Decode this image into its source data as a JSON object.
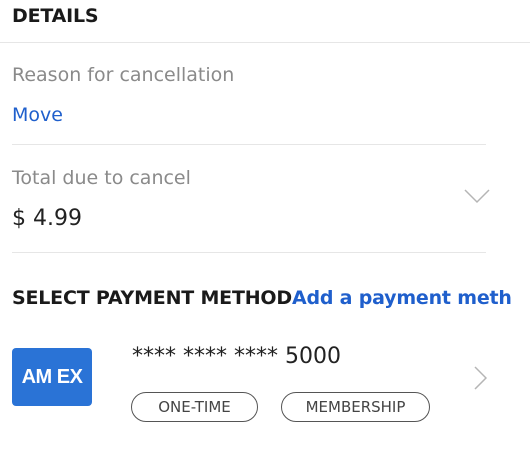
{
  "details": {
    "header": "DETAILS",
    "reason": {
      "label": "Reason for cancellation",
      "value": "Move"
    },
    "total": {
      "label": "Total due to cancel",
      "value": "$ 4.99",
      "expand_icon": "chevron-down-icon"
    }
  },
  "payment": {
    "header": "SELECT PAYMENT METHOD",
    "add_link": "Add a payment meth",
    "card": {
      "brand_logo_text": "AM EX",
      "number": "**** **** **** 5000",
      "tags": [
        "ONE-TIME",
        "MEMBERSHIP"
      ],
      "open_icon": "chevron-right-icon"
    }
  },
  "colors": {
    "accent": "#1f5fcc",
    "amex_blue": "#2a73d6",
    "muted_text": "#8a8a8a",
    "divider": "#e6e6e6"
  }
}
